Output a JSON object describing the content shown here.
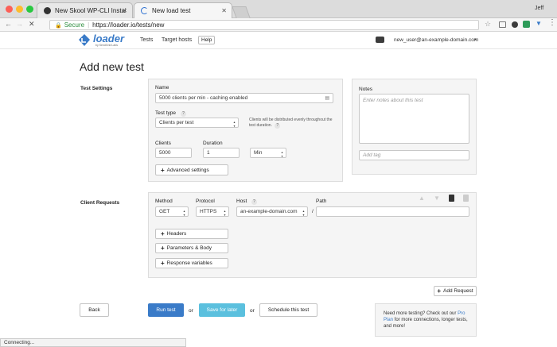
{
  "browser": {
    "tabs": [
      {
        "label": "New Skool WP-CLI Installatio"
      },
      {
        "label": "New load test"
      }
    ],
    "profile_name": "Jeff",
    "secure_label": "Secure",
    "url": "https://loader.io/tests/new",
    "status": "Connecting..."
  },
  "site": {
    "logo_text": "loader",
    "logo_sub": "by SendGrid Labs",
    "nav": {
      "tests": "Tests",
      "target_hosts": "Target hosts",
      "help": "Help"
    },
    "user": "new_user@an-example-domain.com"
  },
  "page": {
    "title": "Add new test"
  },
  "test_settings": {
    "section": "Test Settings",
    "name_label": "Name",
    "name_value": "5000 clients per min - caching enabled",
    "type_label": "Test type",
    "type_value": "Clients per test",
    "type_help": "Clients will be distributed evenly throughout the test duration.",
    "clients_label": "Clients",
    "clients_value": "5000",
    "duration_label": "Duration",
    "duration_value": "1",
    "unit_value": "Min",
    "advanced_label": "Advanced settings",
    "help_mark": "?"
  },
  "notes": {
    "label": "Notes",
    "placeholder": "Enter notes about this test",
    "tag_placeholder": "Add tag"
  },
  "client_requests": {
    "section": "Client Requests",
    "method_label": "Method",
    "method_value": "GET",
    "protocol_label": "Protocol",
    "protocol_value": "HTTPS",
    "host_label": "Host",
    "host_value": "an-example-domain.com",
    "path_label": "Path",
    "slash": "/",
    "path_value": "",
    "buttons": [
      "Headers",
      "Parameters & Body",
      "Response variables"
    ],
    "add_request": "Add Request"
  },
  "actions": {
    "back": "Back",
    "run": "Run test",
    "or1": "or",
    "save": "Save for later",
    "or2": "or",
    "schedule": "Schedule this test"
  },
  "promo": {
    "text_before": "Need more testing? Check out our ",
    "link": "Pro Plan",
    "text_after": " for more connections, longer tests, and more!"
  },
  "colors": {
    "primary": "#3a7bc8",
    "save": "#5bc0de",
    "accent": "#2a8c3c"
  }
}
